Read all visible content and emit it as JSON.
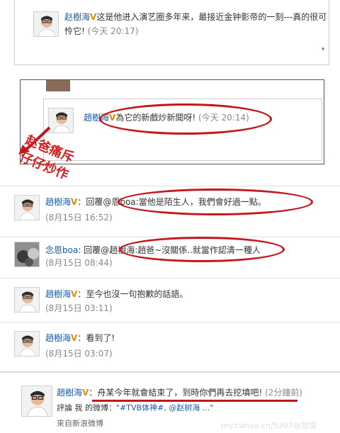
{
  "top_comment": {
    "name": "赵樹海",
    "text": "这是他进入演艺圈多年来，最接近金钟影帝的一刻---真的很可",
    "text2": "怜它! ",
    "time": "(今天 20:17)"
  },
  "mid_comment": {
    "name": "趙樹海",
    "text": "為它的新戲炒新聞呀! ",
    "time": "(今天 20:14)"
  },
  "annotation": {
    "line1": "赵爸痛斥",
    "line2": "仔仔炒作"
  },
  "comments": [
    {
      "name": "趙樹海",
      "text_prefix": "回覆@",
      "text_rest": "恩boa:當他是陌生人，我們會好過一點。",
      "time": "(8月15日 16:52)"
    },
    {
      "name": "念恩boa",
      "text_prefix": ": 回覆@",
      "text_rest": "趙樹海:趙爸~沒關係..就當作認清一種人",
      "time": "(8月15日 08:44)"
    },
    {
      "name": "趙樹海",
      "text_prefix": "",
      "text_rest": "：至今也沒一句抱歉的話語。",
      "time": "(8月15日 03:11)"
    },
    {
      "name": "趙樹海",
      "text_prefix": "",
      "text_rest": "：看到了!",
      "time": "(8月15日 03:07)"
    }
  ],
  "bottom_post": {
    "name": "趙樹海",
    "text": "：舟某今年就會結束了，到時你們再去挖墳吧! ",
    "time": "(2分鐘前)",
    "comment_label": "評論 我 的微博：",
    "comment_text": "\"#TVB体神#, @赵树海 ...\"",
    "source": "來自新浪微博",
    "watermark": "my.tianya.cn/5307@悠悦"
  }
}
